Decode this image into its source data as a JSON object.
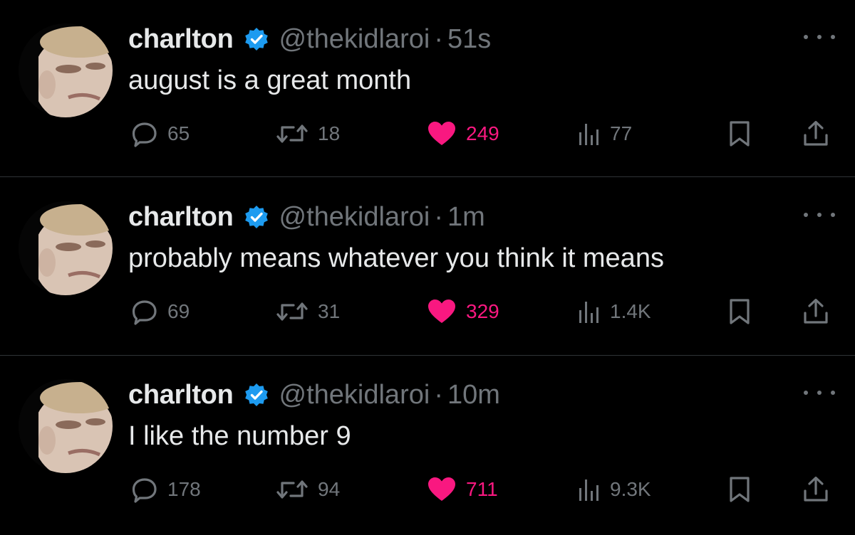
{
  "colors": {
    "background": "#000000",
    "text": "#e7e9ea",
    "muted": "#71767b",
    "like": "#f91880",
    "verified": "#1d9bf0",
    "divider": "#2f3336"
  },
  "tweets": [
    {
      "name": "charlton",
      "handle": "@thekidlaroi",
      "separator": "·",
      "time": "51s",
      "text": "august is a great month",
      "replies": "65",
      "retweets": "18",
      "likes": "249",
      "views": "77",
      "liked": true
    },
    {
      "name": "charlton",
      "handle": "@thekidlaroi",
      "separator": "·",
      "time": "1m",
      "text": "probably means whatever you think it means",
      "replies": "69",
      "retweets": "31",
      "likes": "329",
      "views": "1.4K",
      "liked": true
    },
    {
      "name": "charlton",
      "handle": "@thekidlaroi",
      "separator": "·",
      "time": "10m",
      "text": "I like the number 9",
      "replies": "178",
      "retweets": "94",
      "likes": "711",
      "views": "9.3K",
      "liked": true
    }
  ],
  "icons": {
    "reply": "reply-icon",
    "retweet": "retweet-icon",
    "like": "heart-icon",
    "views": "views-icon",
    "bookmark": "bookmark-icon",
    "share": "share-icon",
    "more": "more-icon",
    "verified": "verified-badge-icon"
  }
}
